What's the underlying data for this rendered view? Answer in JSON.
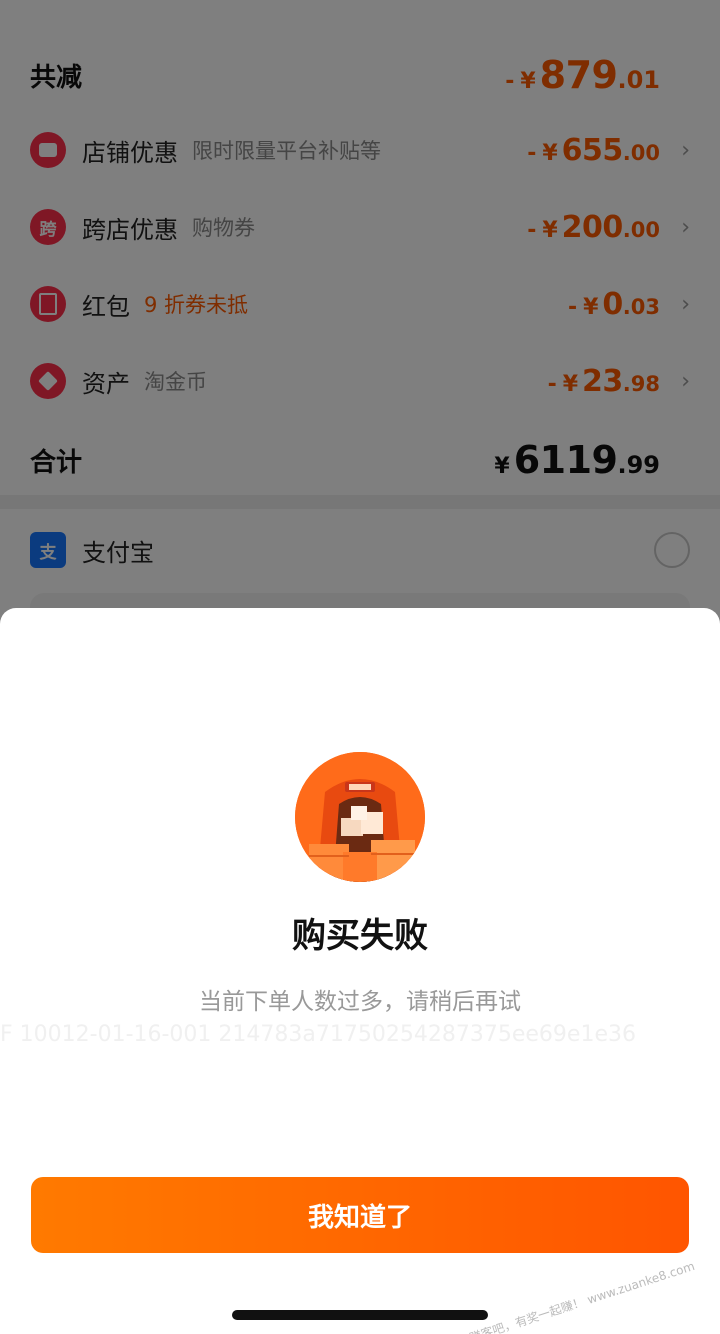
{
  "summary": {
    "discount_title": "共减",
    "discount_amount": {
      "minus": "-",
      "yen": "¥",
      "int": "879",
      "dec": ".01"
    },
    "rows": [
      {
        "icon": "shop-icon",
        "label": "店铺优惠",
        "hint": "限时限量平台补贴等",
        "amount": {
          "minus": "-",
          "yen": "¥",
          "int": "655",
          "dec": ".00"
        }
      },
      {
        "icon": "cross-store-icon",
        "icon_text": "跨",
        "label": "跨店优惠",
        "hint": "购物券",
        "amount": {
          "minus": "-",
          "yen": "¥",
          "int": "200",
          "dec": ".00"
        }
      },
      {
        "icon": "red-packet-icon",
        "label": "红包",
        "hint": "9 折券未抵",
        "amount": {
          "minus": "-",
          "yen": "¥",
          "int": "0",
          "dec": ".03"
        }
      },
      {
        "icon": "tag-icon",
        "label": "资产",
        "hint": "淘金币",
        "amount": {
          "minus": "-",
          "yen": "¥",
          "int": "23",
          "dec": ".98"
        }
      }
    ],
    "total_title": "合计",
    "total_amount": {
      "yen": "¥",
      "int": "6119",
      "dec": ".99"
    },
    "chevron": "›"
  },
  "payment": {
    "alipay_icon_text": "支",
    "alipay_label": "支付宝"
  },
  "dialog": {
    "title": "购买失败",
    "message": "当前下单人数过多，请稍后再试",
    "watermark": "F 10012-01-16-001 214783a71750254287375ee69e1e36",
    "button": "我知道了",
    "corner_mark": "赚客吧，有奖一起赚！ www.zuanke8.com"
  },
  "colors": {
    "accent": "#ff5a00",
    "button_start": "#ff7a00",
    "button_end": "#ff5500",
    "icon_red": "#ff2e4a",
    "alipay_blue": "#1677ff"
  }
}
